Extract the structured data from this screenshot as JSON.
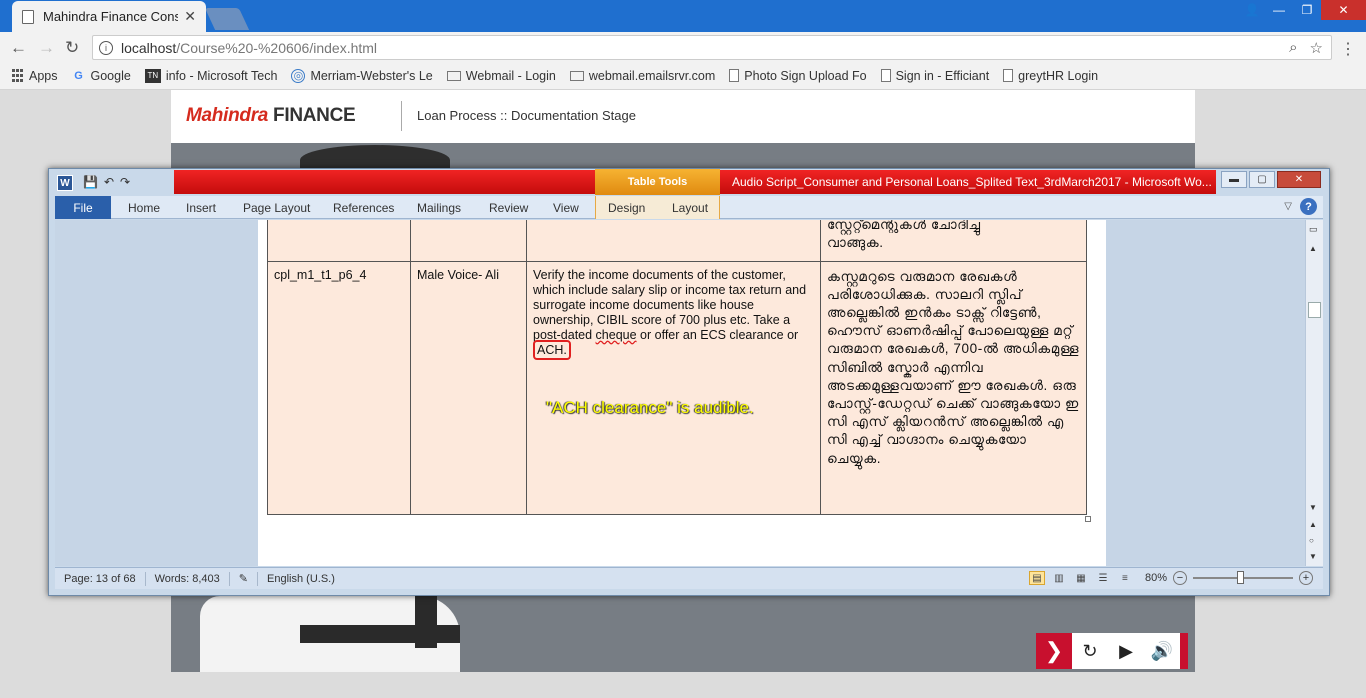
{
  "browser": {
    "tab_title": "Mahindra Finance Consu",
    "tab_close": "✕",
    "url_host": "localhost",
    "url_path": "/Course%20-%20606/index.html",
    "bookmarks": [
      {
        "label": "Apps",
        "icon": "apps-grid-icon"
      },
      {
        "label": "Google",
        "icon": "google-icon"
      },
      {
        "label": "info - Microsoft Tech",
        "icon": "tn-icon"
      },
      {
        "label": "Merriam-Webster's Le",
        "icon": "globe-icon"
      },
      {
        "label": "Webmail - Login",
        "icon": "mail-icon"
      },
      {
        "label": "webmail.emailsrvr.com",
        "icon": "mail-icon"
      },
      {
        "label": "Photo Sign Upload Fo",
        "icon": "document-icon"
      },
      {
        "label": "Sign in - Efficiant",
        "icon": "document-icon"
      },
      {
        "label": "greytHR Login",
        "icon": "document-icon"
      }
    ]
  },
  "course": {
    "logo_red": "Mahindra",
    "logo_dark": "FINANCE",
    "title": "Loan Process :: Documentation Stage"
  },
  "word": {
    "app_letter": "W",
    "table_tools": "Table Tools",
    "window_title": "Audio Script_Consumer and Personal Loans_Splited Text_3rdMarch2017  -  Microsoft Wo...",
    "ribbon_tabs": [
      "File",
      "Home",
      "Insert",
      "Page Layout",
      "References",
      "Mailings",
      "Review",
      "View",
      "Design",
      "Layout"
    ],
    "help": "?",
    "prev_row_malayalam_tail": "സ്റ്റേറ്റ്മെന്റുകൾ ചോദിച്ചു\nവാങ്ങുക.",
    "row": {
      "id": "cpl_m1_t1_p6_4",
      "voice": "Male Voice- Ali",
      "english_before_cheque": "Verify the income documents of the customer, which include salary slip or income tax return and surrogate income documents like house ownership, CIBIL score of 700 plus etc. Take a post-dated ",
      "english_cheque": "cheque",
      "english_after_cheque": " or offer an ECS clearance or ",
      "english_ach": "ACH.",
      "malayalam": "കസ്റ്റമറുടെ വരുമാന രേഖകൾ പരിശോധിക്കുക. സാലറി സ്ലിപ് അല്ലെങ്കിൽ ഇൻകം ടാക്സ് റിട്ടേൺ, ഹൌസ് ഓണർഷിപ്പ് പോലെയുള്ള മറ്റ് വരുമാന രേഖകൾ, 700-ൽ അധികമുള്ള സിബിൽ സ്കോർ എന്നിവ അടക്കമുള്ളവയാണ് ഈ രേഖകൾ. ഒരു പോസ്റ്റ്-ഡേറ്റഡ് ചെക്ക് വാങ്ങുകയോ ഇ സി എസ് ക്ലിയറൻസ് അല്ലെങ്കിൽ എ സി എച്ച് വാഗ്ദാനം ചെയ്യുകയോ ചെയ്യുക."
    },
    "callout": "\"ACH clearance\" is audible.",
    "status": {
      "page": "Page: 13 of 68",
      "words": "Words: 8,403",
      "language": "English (U.S.)",
      "zoom": "80%"
    }
  },
  "player": {
    "next": "❯",
    "replay": "↻",
    "play": "▶",
    "audio": "🔊"
  }
}
